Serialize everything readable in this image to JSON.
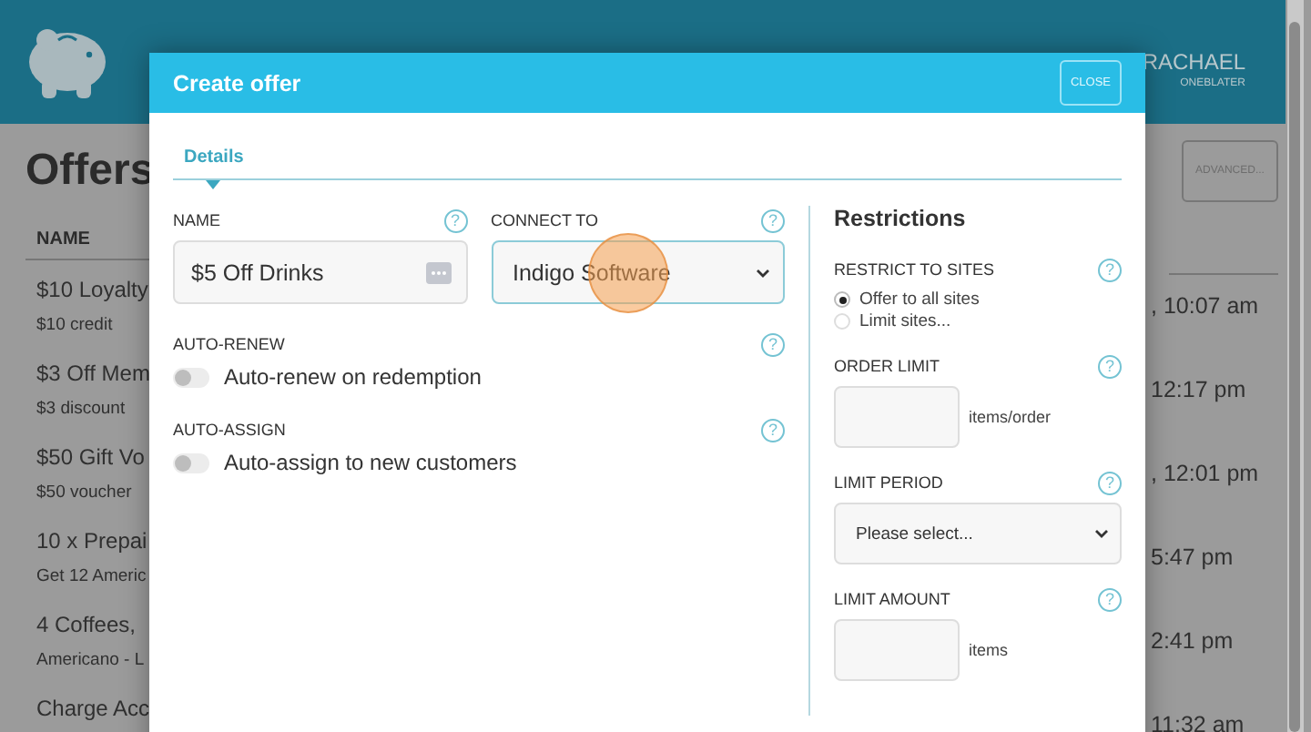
{
  "app_header": {
    "user_name": "RACHAEL",
    "user_sub": "ONEBLATER"
  },
  "page": {
    "title": "Offers",
    "advanced_button": "ADVANCED...",
    "column_header": "NAME",
    "rows": [
      {
        "name": "$10 Loyalty",
        "detail": "$10 credit",
        "time": ", 10:07 am"
      },
      {
        "name": "$3 Off Mem",
        "detail": "$3 discount",
        "time": "12:17 pm"
      },
      {
        "name": "$50 Gift Vo",
        "detail": "$50 voucher",
        "time": ", 12:01 pm"
      },
      {
        "name": "10 x Prepai",
        "detail": "Get 12 Americ",
        "time": "5:47 pm"
      },
      {
        "name": "4 Coffees,",
        "detail": "Americano - L",
        "time": "2:41 pm"
      },
      {
        "name": "Charge Acc",
        "time": "11:32 am"
      }
    ]
  },
  "dialog": {
    "title": "Create offer",
    "close_button": "CLOSE",
    "tabs": [
      {
        "label": "Details",
        "selected": true
      }
    ],
    "name_field": {
      "label": "NAME",
      "help": "?",
      "value": "$5 Off Drinks"
    },
    "connect_field": {
      "label": "CONNECT TO",
      "help": "?",
      "value": "Indigo Software"
    },
    "toggles": [
      {
        "label": "AUTO-RENEW",
        "help": "?",
        "text": "Auto-renew on redemption",
        "on": false
      },
      {
        "label": "AUTO-ASSIGN",
        "help": "?",
        "text": "Auto-assign to new customers",
        "on": false
      }
    ],
    "restrictions": {
      "title": "Restrictions",
      "sites": {
        "label": "RESTRICT TO SITES",
        "help": "?",
        "options": [
          {
            "label": "Offer to all sites",
            "selected": true
          },
          {
            "label": "Limit sites...",
            "selected": false
          }
        ]
      },
      "order_limit": {
        "label": "ORDER LIMIT",
        "help": "?",
        "unit": "items/order"
      },
      "limit_period": {
        "label": "LIMIT PERIOD",
        "help": "?",
        "placeholder": "Please select..."
      },
      "limit_amount": {
        "label": "LIMIT AMOUNT",
        "help": "?",
        "unit": "items"
      }
    }
  }
}
